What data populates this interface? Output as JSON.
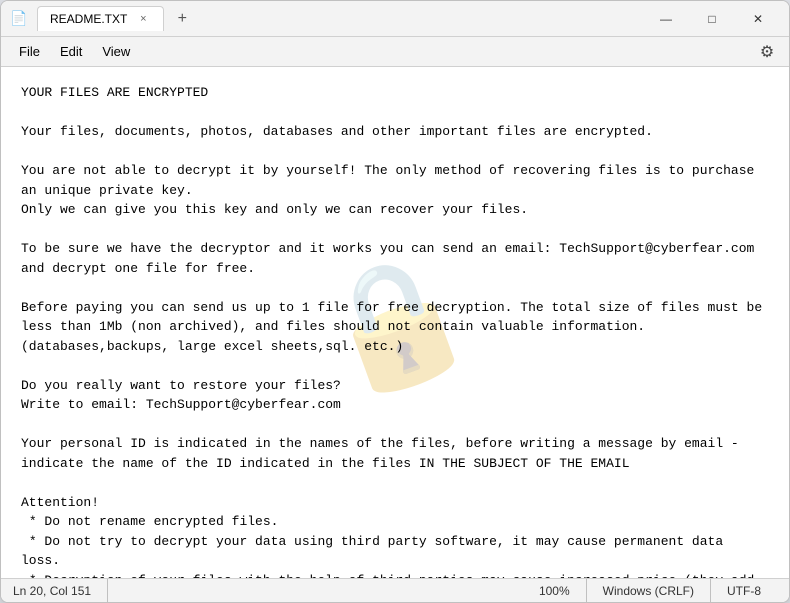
{
  "window": {
    "title": "README.TXT",
    "icon": "📄"
  },
  "tabs": [
    {
      "label": "README.TXT",
      "close": "×"
    }
  ],
  "tab_new": "+",
  "window_controls": {
    "minimize": "—",
    "maximize": "□",
    "close": "✕"
  },
  "menu": {
    "file": "File",
    "edit": "Edit",
    "view": "View"
  },
  "gear_symbol": "⚙",
  "watermark": "🔒",
  "content": "YOUR FILES ARE ENCRYPTED\n\nYour files, documents, photos, databases and other important files are encrypted.\n\nYou are not able to decrypt it by yourself! The only method of recovering files is to purchase\nan unique private key.\nOnly we can give you this key and only we can recover your files.\n\nTo be sure we have the decryptor and it works you can send an email: TechSupport@cyberfear.com\nand decrypt one file for free.\n\nBefore paying you can send us up to 1 file for free decryption. The total size of files must be\nless than 1Mb (non archived), and files should not contain valuable information.\n(databases,backups, large excel sheets,sql. etc.)\n\nDo you really want to restore your files?\nWrite to email: TechSupport@cyberfear.com\n\nYour personal ID is indicated in the names of the files, before writing a message by email -\nindicate the name of the ID indicated in the files IN THE SUBJECT OF THE EMAIL\n\nAttention!\n * Do not rename encrypted files.\n * Do not try to decrypt your data using third party software, it may cause permanent data\nloss.\n * Decryption of your files with the help of third parties may cause increased price (they add\ntheir fee to our) or you can become a victim of a scam.",
  "status_bar": {
    "position": "Ln 20, Col 151",
    "zoom": "100%",
    "line_ending": "Windows (CRLF)",
    "encoding": "UTF-8"
  }
}
